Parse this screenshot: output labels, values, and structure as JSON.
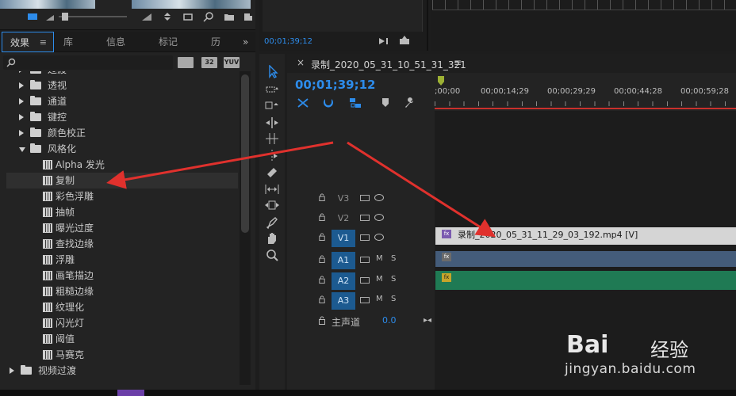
{
  "effects_panel": {
    "tabs": [
      "效果",
      "库",
      "信息",
      "标记",
      "历"
    ],
    "more_glyph": "»",
    "tab_menu_glyph": "≡",
    "filters": [
      "32",
      "YUV"
    ],
    "tree": [
      {
        "label": "过渡",
        "type": "folder",
        "expanded": false
      },
      {
        "label": "透视",
        "type": "folder",
        "expanded": false
      },
      {
        "label": "通道",
        "type": "folder",
        "expanded": false
      },
      {
        "label": "键控",
        "type": "folder",
        "expanded": false
      },
      {
        "label": "颜色校正",
        "type": "folder",
        "expanded": false
      },
      {
        "label": "风格化",
        "type": "folder",
        "expanded": true
      },
      {
        "label": "Alpha 发光",
        "type": "effect"
      },
      {
        "label": "复制",
        "type": "effect",
        "selected": true
      },
      {
        "label": "彩色浮雕",
        "type": "effect"
      },
      {
        "label": "抽帧",
        "type": "effect"
      },
      {
        "label": "曝光过度",
        "type": "effect"
      },
      {
        "label": "查找边缘",
        "type": "effect"
      },
      {
        "label": "浮雕",
        "type": "effect"
      },
      {
        "label": "画笔描边",
        "type": "effect"
      },
      {
        "label": "粗糙边缘",
        "type": "effect"
      },
      {
        "label": "纹理化",
        "type": "effect"
      },
      {
        "label": "闪光灯",
        "type": "effect"
      },
      {
        "label": "阈值",
        "type": "effect"
      },
      {
        "label": "马赛克",
        "type": "effect"
      },
      {
        "label": "视频过渡",
        "type": "folder",
        "expanded": false,
        "level": 0
      }
    ]
  },
  "program_monitor": {
    "timecode": "00;01;39;12"
  },
  "timeline": {
    "close_glyph": "×",
    "sequence_name": "录制_2020_05_31_10_51_31_321",
    "menu_glyph": "≡",
    "timecode": "00;01;39;12",
    "ruler_labels": [
      ";00;00",
      "00;00;14;29",
      "00;00;29;29",
      "00;00;44;28",
      "00;00;59;28"
    ],
    "tracks": [
      {
        "name": "V3",
        "kind": "video",
        "targeted": false
      },
      {
        "name": "V2",
        "kind": "video",
        "targeted": false
      },
      {
        "name": "V1",
        "kind": "video",
        "targeted": true
      },
      {
        "name": "A1",
        "kind": "audio",
        "targeted": true
      },
      {
        "name": "A2",
        "kind": "audio",
        "targeted": true
      },
      {
        "name": "A3",
        "kind": "audio",
        "targeted": true
      }
    ],
    "audio_m": "M",
    "audio_s": "S",
    "master_label": "主声道",
    "master_value": "0.0",
    "clip_v1_name": "录制_2020_05_31_11_29_03_192.mp4 [V]",
    "fx_badge": "fx"
  },
  "watermark": {
    "brand": "Bai",
    "brand_cn": "经验",
    "url": "jingyan.baidu.com"
  },
  "colors": {
    "accent": "#2d8ceb",
    "arrow": "#e0312d",
    "video_clip": "#d5d5d5",
    "audio_a1": "#445c7a",
    "audio_a2": "#1f7a54"
  }
}
